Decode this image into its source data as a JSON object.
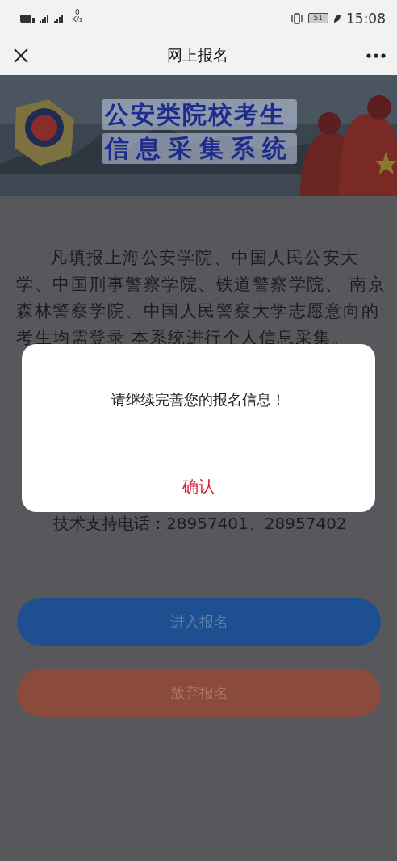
{
  "status_bar": {
    "speed_value": "0",
    "speed_unit": "K/s",
    "battery": "51",
    "time": "15:08"
  },
  "nav_bar": {
    "title": "网上报名"
  },
  "banner": {
    "kind": "picture",
    "title_lines": [
      "公安类院校考生",
      "信息采集系统"
    ]
  },
  "intro_lines": [
    "凡填报上海公安学院、中国人民公安大",
    "学、中国刑事警察学院、铁道警察学院、 南京",
    "森林警察学院、中国人民警察大学志愿意向的",
    "考生均需登录 本系统进行个人信息采集。"
  ],
  "support": "技术支持电话：28957401、28957402",
  "buttons": [
    {
      "label": "进入报名",
      "kind": "primary"
    },
    {
      "label": "放弃报名",
      "kind": "danger"
    }
  ],
  "dialog": {
    "message": "请继续完善您的报名信息！",
    "confirm": "确认"
  }
}
